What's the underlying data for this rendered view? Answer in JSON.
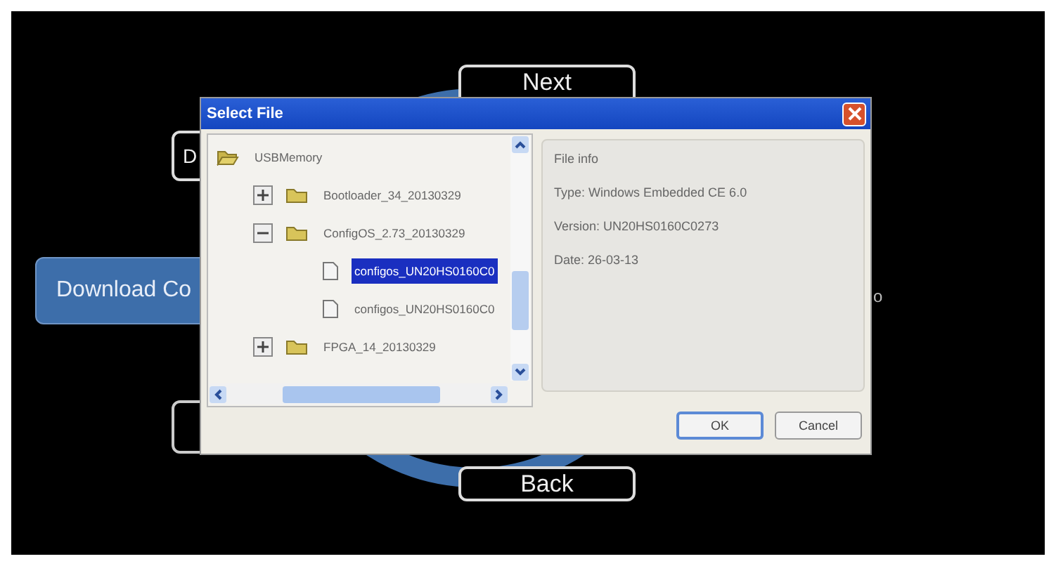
{
  "screen_buttons": [
    {
      "label": "Next",
      "kind": "outline"
    },
    {
      "label": "D",
      "kind": "outline"
    },
    {
      "label": "Download Co",
      "kind": "filled"
    },
    {
      "label": "o",
      "kind": "text"
    },
    {
      "label": "Back",
      "kind": "outline"
    }
  ],
  "dialog": {
    "title": "Select File",
    "tree": [
      {
        "label": "USBMemory",
        "kind": "folder",
        "expanded": true,
        "children": [
          {
            "label": "Bootloader_34_20130329",
            "kind": "folder",
            "expanded": false
          },
          {
            "label": "ConfigOS_2.73_20130329",
            "kind": "folder",
            "expanded": true,
            "children": [
              {
                "label": "configos_UN20HS0160C0",
                "kind": "file",
                "selected": true
              },
              {
                "label": "configos_UN20HS0160C0",
                "kind": "file",
                "selected": false
              }
            ]
          },
          {
            "label": "FPGA_14_20130329",
            "kind": "folder",
            "expanded": false
          }
        ]
      }
    ],
    "file_info": {
      "title": "File info",
      "lines": [
        "Type: Windows Embedded CE 6.0",
        "Version: UN20HS0160C0273",
        "Date: 26-03-13"
      ]
    },
    "buttons": [
      {
        "label": "OK",
        "selected": true
      },
      {
        "label": "Cancel",
        "selected": false
      }
    ]
  }
}
